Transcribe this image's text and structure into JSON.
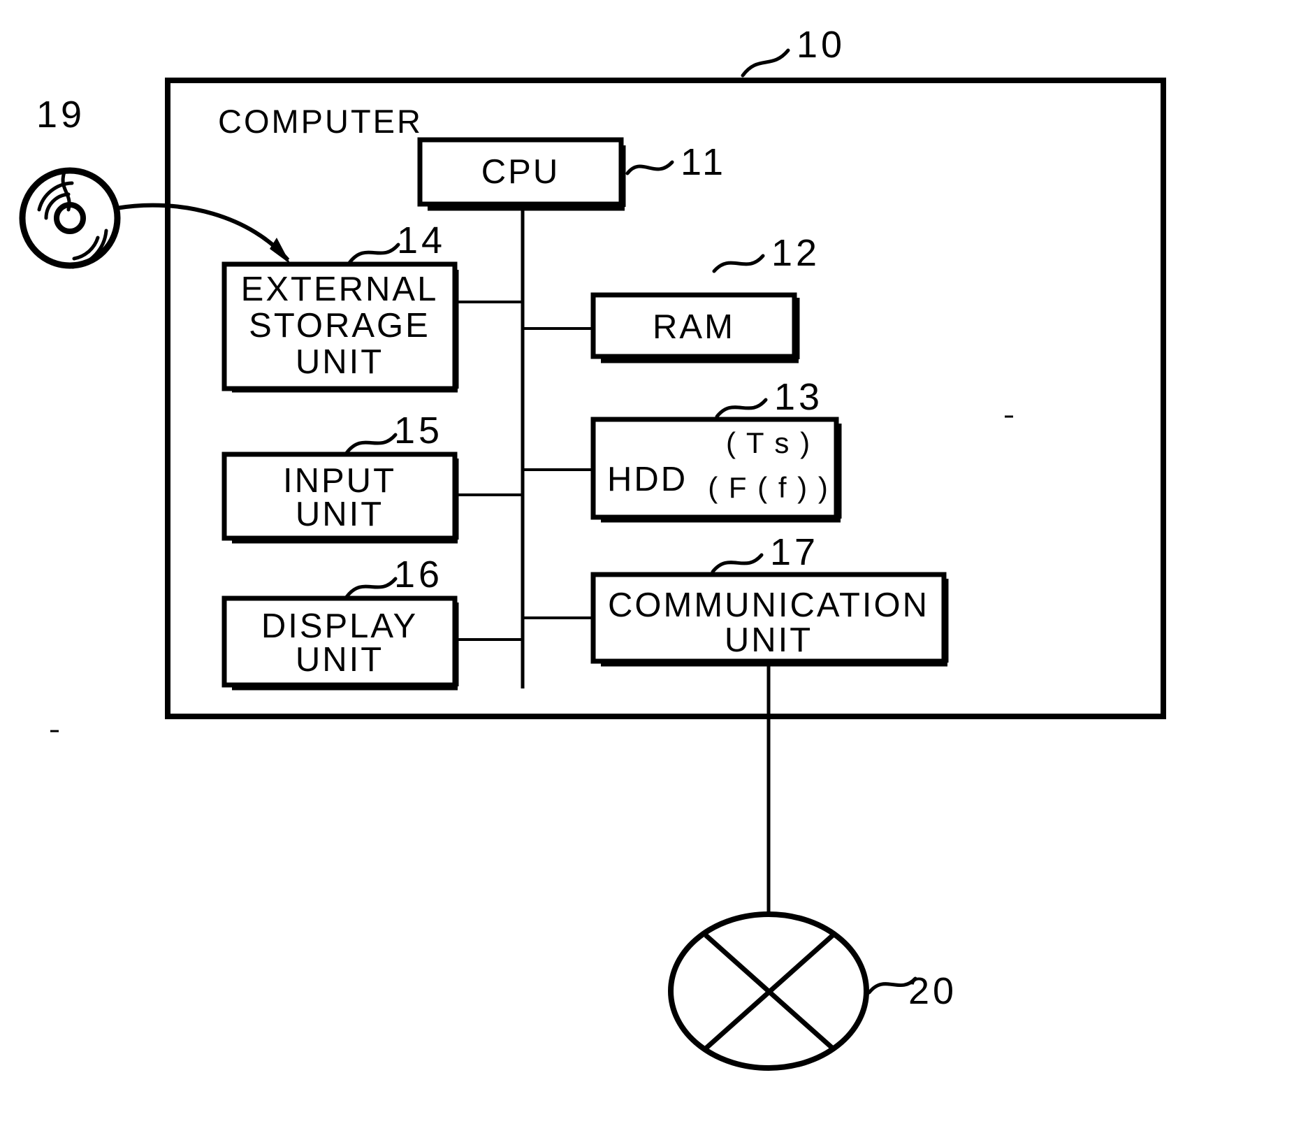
{
  "figure": {
    "type": "patent-block-diagram",
    "outer": {
      "label": "COMPUTER",
      "ref": "10"
    },
    "blocks": [
      {
        "id": "cpu",
        "label": "CPU",
        "ref": "11"
      },
      {
        "id": "ram",
        "label": "RAM",
        "ref": "12"
      },
      {
        "id": "hdd",
        "label": "HDD",
        "ref": "13",
        "notes": [
          "( T s )",
          "( F ( f ) )"
        ]
      },
      {
        "id": "external",
        "label": "EXTERNAL\nSTORAGE\nUNIT",
        "ref": "14",
        "line1": "EXTERNAL",
        "line2": "STORAGE",
        "line3": "UNIT"
      },
      {
        "id": "input",
        "label": "INPUT\nUNIT",
        "ref": "15",
        "line1": "INPUT",
        "line2": "UNIT"
      },
      {
        "id": "display",
        "label": "DISPLAY\nUNIT",
        "ref": "16",
        "line1": "DISPLAY",
        "line2": "UNIT"
      },
      {
        "id": "comm",
        "label": "COMMUNICATION\nUNIT",
        "ref": "17",
        "line1": "COMMUNICATION",
        "line2": "UNIT"
      }
    ],
    "externals": [
      {
        "id": "disc",
        "icon": "optical-disc-icon",
        "ref": "19"
      },
      {
        "id": "network",
        "icon": "network-node-icon",
        "ref": "20"
      }
    ],
    "colors": {
      "ink": "#000000",
      "paper": "#ffffff"
    }
  }
}
